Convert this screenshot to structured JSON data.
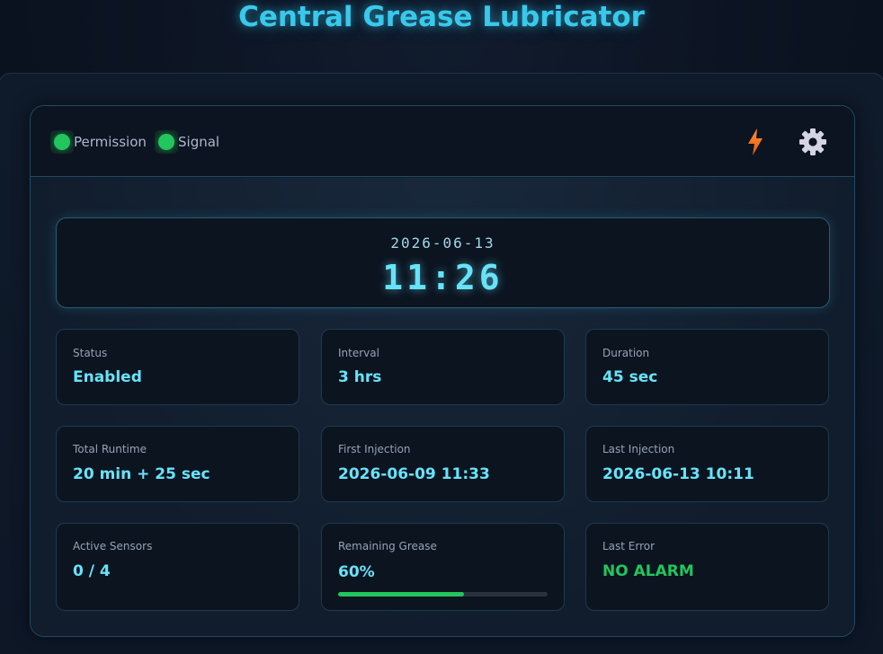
{
  "app": {
    "title": "Central Grease Lubricator"
  },
  "header": {
    "indicators": [
      {
        "label": "Permission",
        "state_color": "#22c55e"
      },
      {
        "label": "Signal",
        "state_color": "#22c55e"
      }
    ],
    "actions": [
      {
        "icon": "lightning-icon",
        "color": "#f97316"
      },
      {
        "icon": "gear-icon",
        "color": "#d8d8e8"
      }
    ]
  },
  "clock": {
    "date": "2026-06-13",
    "time": "11:26"
  },
  "tiles": [
    {
      "label": "Status",
      "value": "Enabled"
    },
    {
      "label": "Interval",
      "value": "3 hrs"
    },
    {
      "label": "Duration",
      "value": "45 sec"
    },
    {
      "label": "Total Runtime",
      "value": "20 min + 25 sec"
    },
    {
      "label": "First Injection",
      "value": "2026-06-09 11:33"
    },
    {
      "label": "Last Injection",
      "value": "2026-06-13 10:11"
    },
    {
      "label": "Active Sensors",
      "value": "0 / 4"
    },
    {
      "label": "Remaining Grease",
      "value": "60%",
      "progress_fraction": 0.6
    },
    {
      "label": "Last Error",
      "value": "NO ALARM",
      "value_color": "#22c55e"
    }
  ],
  "colors": {
    "accent": "#38c9ec",
    "value": "#67e3f9",
    "ok": "#22c55e",
    "background": "#0b1220"
  }
}
